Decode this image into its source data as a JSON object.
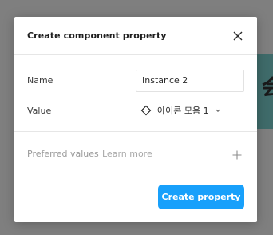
{
  "dialog": {
    "title": "Create component property",
    "close_icon": "close-icon"
  },
  "fields": {
    "name_label": "Name",
    "name_value": "Instance 2",
    "value_label": "Value",
    "value_selected": "아이콘 모음 1",
    "value_icon": "component-instance-diamond-icon",
    "value_chevron": "chevron-down-icon"
  },
  "preferred": {
    "label": "Preferred values",
    "learn_more": "Learn more",
    "add_icon": "plus-icon"
  },
  "footer": {
    "create_label": "Create property"
  },
  "background": {
    "glyph": "会"
  },
  "colors": {
    "accent": "#18a0fb",
    "overlay": "#7f7f7f",
    "bg_strip": "#3f6b6a"
  }
}
